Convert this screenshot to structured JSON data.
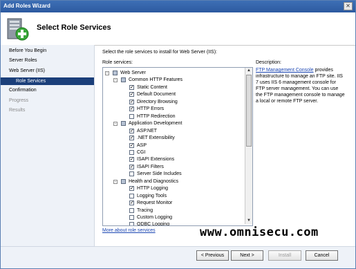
{
  "window": {
    "title": "Add Roles Wizard"
  },
  "banner": {
    "title": "Select Role Services"
  },
  "nav": {
    "items": [
      {
        "label": "Before You Begin",
        "state": "normal"
      },
      {
        "label": "Server Roles",
        "state": "normal"
      },
      {
        "label": "Web Server (IIS)",
        "state": "normal"
      },
      {
        "label": "Role Services",
        "state": "active"
      },
      {
        "label": "Confirmation",
        "state": "normal"
      },
      {
        "label": "Progress",
        "state": "disabled"
      },
      {
        "label": "Results",
        "state": "disabled"
      }
    ]
  },
  "content": {
    "instruction": "Select the role services to install for Web Server (IIS):",
    "role_services_label": "Role services:",
    "description_label": "Description:",
    "description_link": "FTP Management Console",
    "description_text": " provides infrastructure to manage an FTP site. IIS 7 uses IIS 6 management console for FTP server management. You can use the FTP management console to manage a local or remote FTP server.",
    "more_link": "More about role services"
  },
  "tree": {
    "items": [
      {
        "label": "Web Server",
        "level": 0,
        "expander": "-",
        "check": "partial"
      },
      {
        "label": "Common HTTP Features",
        "level": 1,
        "expander": "-",
        "check": "partial"
      },
      {
        "label": "Static Content",
        "level": 2,
        "check": "checked"
      },
      {
        "label": "Default Document",
        "level": 2,
        "check": "checked"
      },
      {
        "label": "Directory Browsing",
        "level": 2,
        "check": "checked"
      },
      {
        "label": "HTTP Errors",
        "level": 2,
        "check": "checked"
      },
      {
        "label": "HTTP Redirection",
        "level": 2,
        "check": "unchecked"
      },
      {
        "label": "Application Development",
        "level": 1,
        "expander": "-",
        "check": "partial"
      },
      {
        "label": "ASP.NET",
        "level": 2,
        "check": "checked"
      },
      {
        "label": ".NET Extensibility",
        "level": 2,
        "check": "checked"
      },
      {
        "label": "ASP",
        "level": 2,
        "check": "checked"
      },
      {
        "label": "CGI",
        "level": 2,
        "check": "unchecked"
      },
      {
        "label": "ISAPI Extensions",
        "level": 2,
        "check": "checked"
      },
      {
        "label": "ISAPI Filters",
        "level": 2,
        "check": "checked"
      },
      {
        "label": "Server Side Includes",
        "level": 2,
        "check": "unchecked"
      },
      {
        "label": "Health and Diagnostics",
        "level": 1,
        "expander": "-",
        "check": "partial"
      },
      {
        "label": "HTTP Logging",
        "level": 2,
        "check": "checked"
      },
      {
        "label": "Logging Tools",
        "level": 2,
        "check": "unchecked"
      },
      {
        "label": "Request Monitor",
        "level": 2,
        "check": "checked"
      },
      {
        "label": "Tracing",
        "level": 2,
        "check": "unchecked"
      },
      {
        "label": "Custom Logging",
        "level": 2,
        "check": "unchecked"
      },
      {
        "label": "ODBC Logging",
        "level": 2,
        "check": "unchecked"
      }
    ]
  },
  "buttons": {
    "previous": "< Previous",
    "next": "Next >",
    "install": "Install",
    "cancel": "Cancel"
  },
  "close_glyph": "✕",
  "watermark": "www.omnisecu.com",
  "colors": {
    "title_bar": "#2d5aa0",
    "nav_active": "#1b3f7a",
    "link": "#1a45b2"
  }
}
